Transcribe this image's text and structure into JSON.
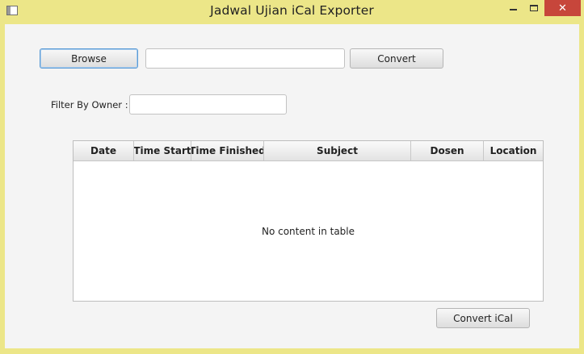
{
  "window": {
    "title": "Jadwal Ujian iCal Exporter",
    "close_glyph": "✕"
  },
  "toolbar": {
    "browse_label": "Browse",
    "path_value": "",
    "convert_label": "Convert"
  },
  "filter": {
    "label": "Filter By Owner :",
    "value": ""
  },
  "table": {
    "columns": [
      "Date",
      "Time Start",
      "Time Finished",
      "Subject",
      "Dosen",
      "Location"
    ],
    "rows": [],
    "empty_text": "No content in table"
  },
  "footer": {
    "convert_ical_label": "Convert iCal"
  },
  "colors": {
    "window_frame": "#ece688",
    "close_button": "#c7463b",
    "focus_border": "#5b9bd5"
  }
}
